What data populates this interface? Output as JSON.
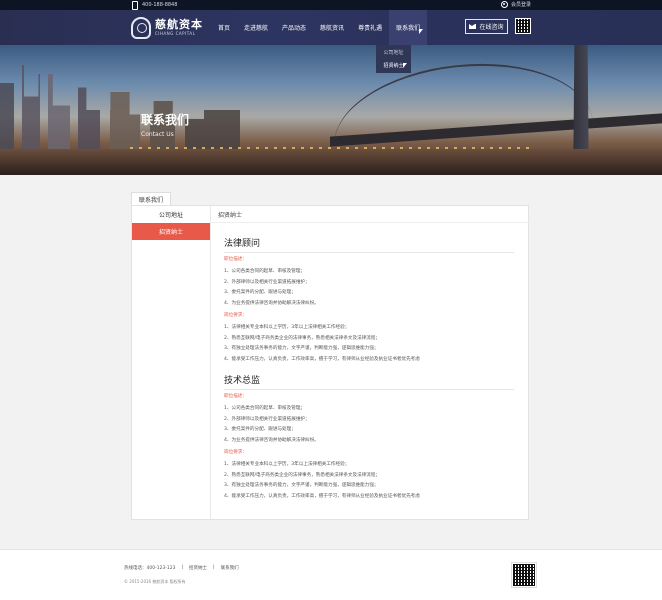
{
  "topbar": {
    "phone": "400-188-8848",
    "login": "会员登录"
  },
  "brand": {
    "name_cn": "慈航资本",
    "name_en": "CIHANG CAPITAL"
  },
  "nav": {
    "items": [
      {
        "label": "首页"
      },
      {
        "label": "走进慈航"
      },
      {
        "label": "产品动态"
      },
      {
        "label": "慈航资讯"
      },
      {
        "label": "尊贵礼遇"
      },
      {
        "label": "联系我们"
      }
    ],
    "online": "在线咨询"
  },
  "dropdown": {
    "items": [
      {
        "label": "公司地址"
      },
      {
        "label": "招贤纳士"
      }
    ]
  },
  "banner": {
    "title": "联系我们",
    "subtitle": "Contact Us"
  },
  "tab": {
    "label": "联系我们"
  },
  "side": {
    "items": [
      {
        "label": "公司地址"
      },
      {
        "label": "招贤纳士"
      }
    ]
  },
  "crumb": "招贤纳士",
  "jobs": [
    {
      "title": "法律顾问",
      "duty_label": "职位描述：",
      "duties": [
        "1、公司各类合同的起草、审核及管理；",
        "2、外部律师以及相关行业渠道拓展维护；",
        "3、委托案件的分配、跟进与处理；",
        "4、为业务提供法律咨询并协助解决法律纠纷。"
      ],
      "req_label": "岗位要求：",
      "reqs": [
        "1、法律相关专业本科以上学历，3年以上法律相关工作经验；",
        "2、熟悉互联网/电子商务类企业的法律事务，熟悉相关法律条文及法律流程；",
        "3、有独立处理法务事务的能力，文字严谨，判断能力强，逻辑思维能力强；",
        "4、能承受工作压力，认真负责，工作效率高，擅于学习，有律师从业经验及执业证书者优先考虑"
      ]
    },
    {
      "title": "技术总监",
      "duty_label": "职位描述：",
      "duties": [
        "1、公司各类合同的起草、审核及管理；",
        "2、外部律师以及相关行业渠道拓展维护；",
        "3、委托案件的分配、跟进与处理；",
        "4、为业务提供法律咨询并协助解决法律纠纷。"
      ],
      "req_label": "岗位要求：",
      "reqs": [
        "1、法律相关专业本科以上学历，3年以上法律相关工作经验；",
        "2、熟悉互联网/电子商务类企业的法律事务，熟悉相关法律条文及法律流程；",
        "3、有独立处理法务事务的能力，文字严谨，判断能力强，逻辑思维能力强；",
        "4、能承受工作压力，认真负责，工作效率高，擅于学习，有律师从业经验及执业证书者优先考虑"
      ]
    }
  ],
  "footer": {
    "hotline": "热线电话：400-123-123",
    "link1": "招贤纳士",
    "link2": "联系我们",
    "copyright": "© 2015-2016  慈航资本  版权所有"
  },
  "colors": {
    "accent": "#e8594a",
    "header": "#2c3460"
  }
}
